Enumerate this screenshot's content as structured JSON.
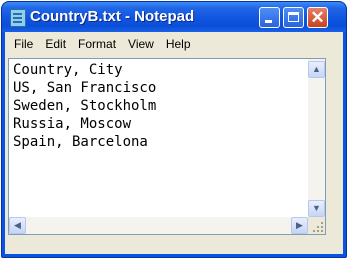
{
  "window": {
    "title": "CountryB.txt - Notepad",
    "icon": "notepad-icon",
    "controls": {
      "minimize": "minimize-icon",
      "maximize": "maximize-icon",
      "close": "close-icon",
      "close_glyph": "✕"
    }
  },
  "menu": [
    "File",
    "Edit",
    "Format",
    "View",
    "Help"
  ],
  "document": {
    "lines": [
      "Country, City",
      "US, San Francisco",
      "Sweden, Stockholm",
      "Russia, Moscow",
      "Spain, Barcelona"
    ]
  },
  "scrollbars": {
    "up": "▲",
    "down": "▼",
    "left": "◀",
    "right": "▶"
  },
  "colors": {
    "title_bar": "#0a54e3",
    "close_button": "#c6431f",
    "menu_bg": "#ece9d8"
  }
}
